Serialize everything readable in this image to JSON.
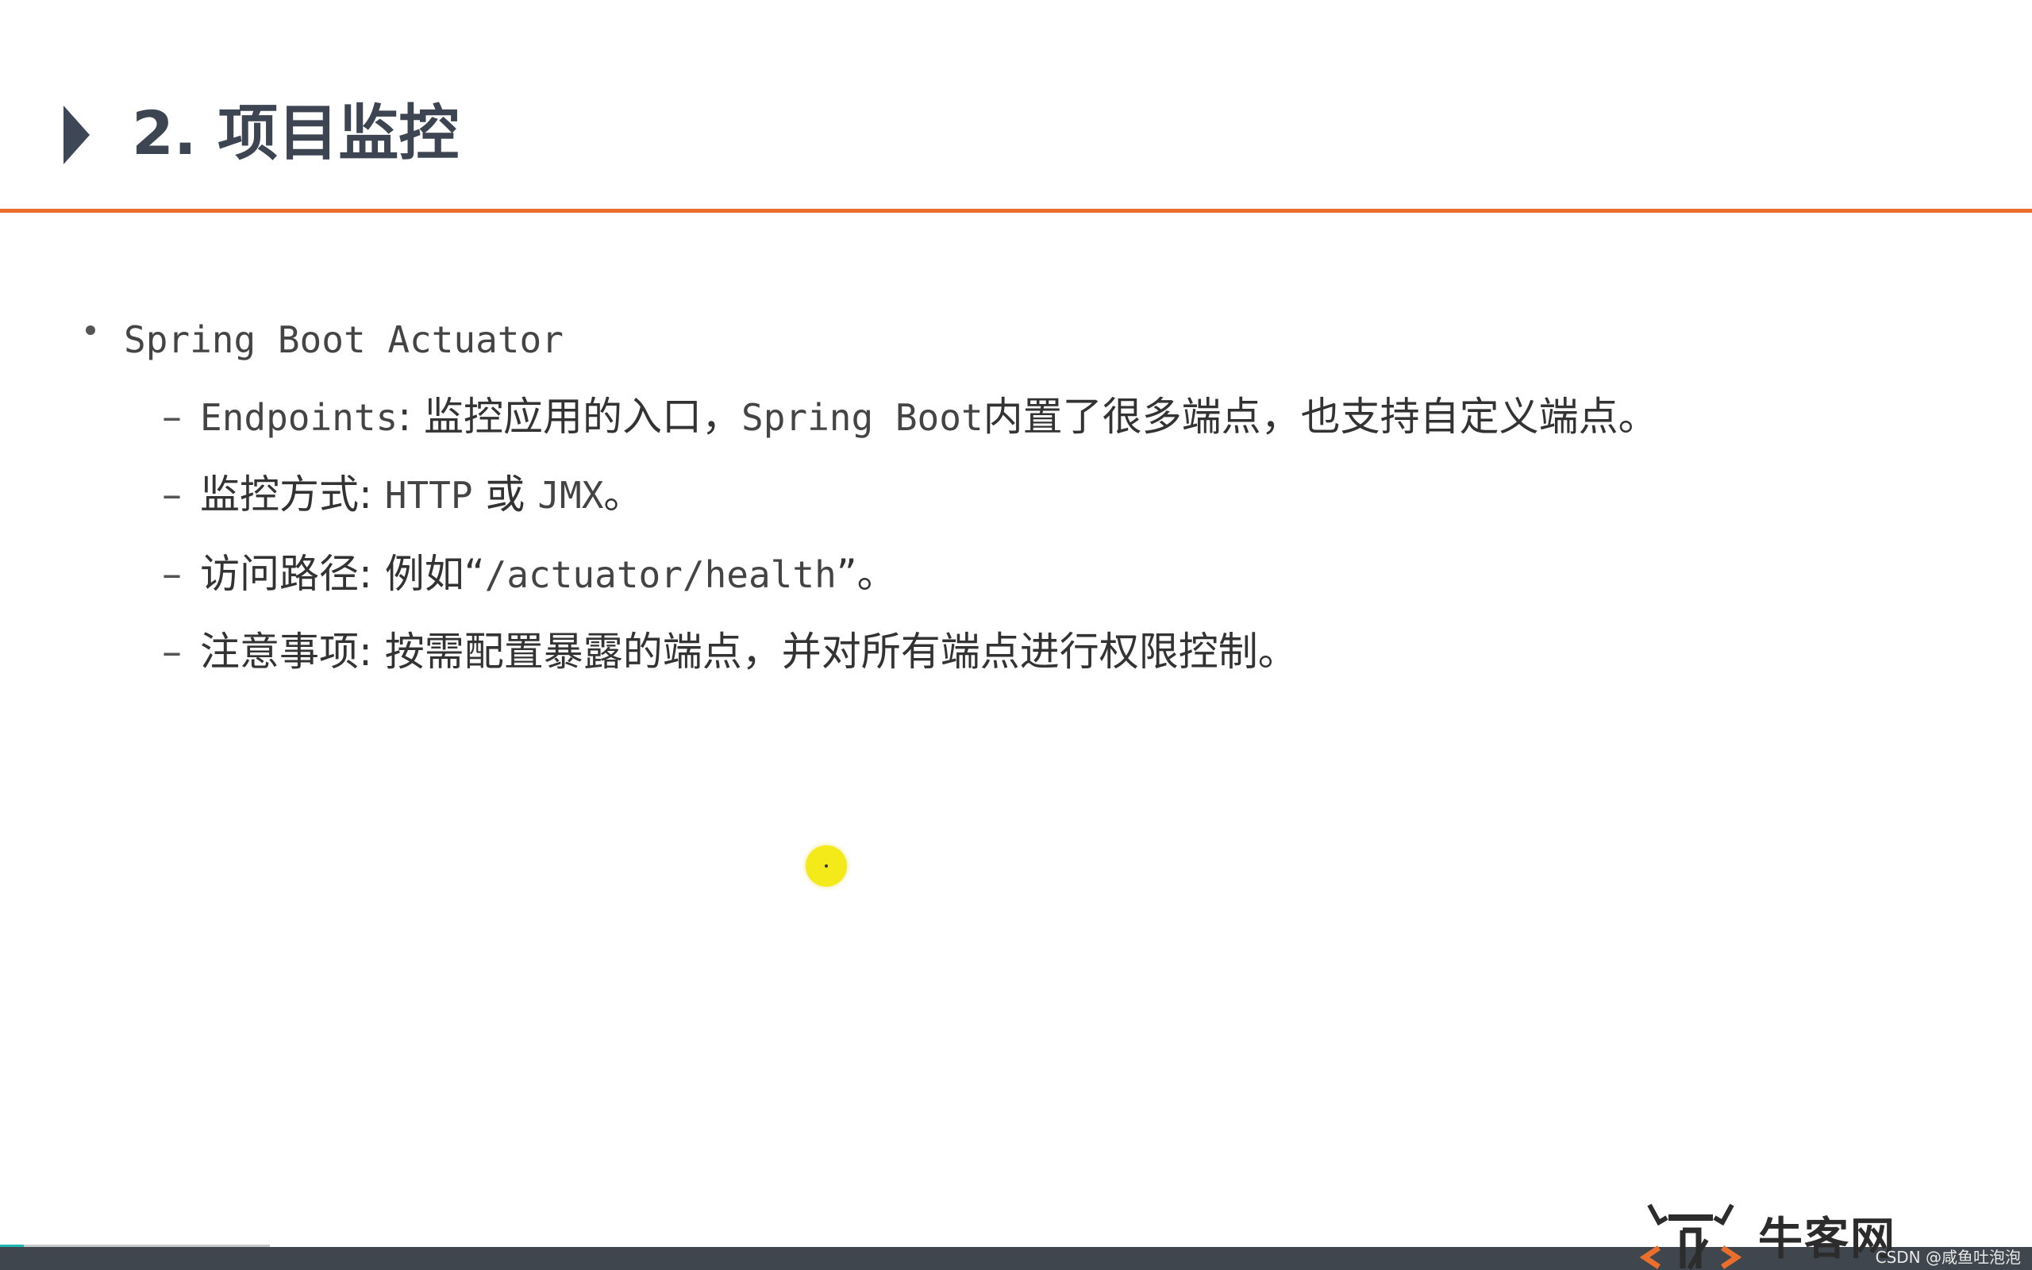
{
  "slide": {
    "title": "2. 项目监控",
    "bullet": "Spring Boot Actuator",
    "items": [
      {
        "parts": [
          "Endpoints",
          ": 监控应用的入口，",
          "Spring Boot",
          "内置了很多端点，也支持自定义端点。"
        ]
      },
      {
        "parts": [
          "监控方式: ",
          "HTTP",
          " 或 ",
          "JMX",
          "。"
        ]
      },
      {
        "parts": [
          "访问路径: 例如“",
          "/actuator/health",
          "”。"
        ]
      },
      {
        "parts": [
          "注意事项: 按需配置暴露的端点，并对所有端点进行权限控制。"
        ]
      }
    ]
  },
  "logo": {
    "text": "牛客网"
  },
  "watermark": "CSDN @咸鱼吐泡泡",
  "colors": {
    "accent_rule": "#ea6f2c",
    "title_arrow": "#3e4756",
    "footer": "#3f464d",
    "cursor_highlight": "#f4ea1a"
  }
}
